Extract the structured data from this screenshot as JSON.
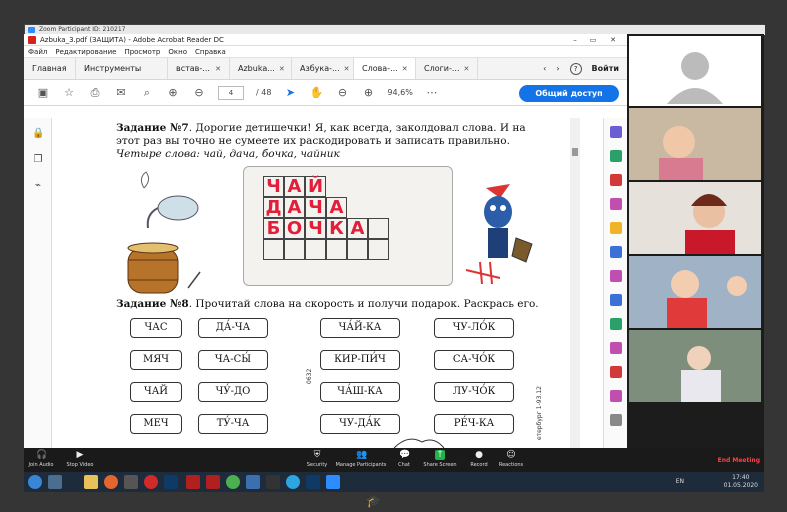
{
  "zoom": {
    "title": "Zoom Participant ID: 210217"
  },
  "acrobat": {
    "title": "Azbuka_3.pdf (ЗАЩИТА) - Adobe Acrobat Reader DC",
    "menu": [
      "Файл",
      "Редактирование",
      "Просмотр",
      "Окно",
      "Справка"
    ],
    "tabs": {
      "home": "Главная",
      "tools": "Инструменты",
      "doc1": "встав-...",
      "doc2": "Azbuka...",
      "doc3": "Азбука-...",
      "doc4": "Слова-...",
      "doc5": "Слоги-..."
    },
    "signin": "Войти",
    "help": "?",
    "page_current": "4",
    "page_total": "/ 48",
    "zoom_level": "94,6%",
    "share_label": "Общий доступ"
  },
  "page": {
    "task7_label": "Задание №7",
    "task7_text": ". Дорогие детишечки! Я, как всегда, заколдовал слова. И на этот раз вы точно не сумеете их раскодировать и записать правильно.",
    "task7_hint": "Четыре слова: чай, дача, бочка, чайник",
    "grid_letters": {
      "row1": [
        "Ч",
        "А",
        "Й"
      ],
      "row2": [
        "Д",
        "А",
        "Ч",
        "А"
      ],
      "row3": [
        "Б",
        "О",
        "Ч",
        "К",
        "А"
      ]
    },
    "task8_label": "Задание №8",
    "task8_text": ". Прочитай слова на скорость и получи подарок. Раскрась его.",
    "words": {
      "c1": [
        "ЧАС",
        "МЯЧ",
        "ЧАЙ",
        "МЕЧ"
      ],
      "c2": [
        "ДА́-ЧА",
        "ЧА-СЫ́",
        "ЧУ́-ДО",
        "ТУ́-ЧА"
      ],
      "c3": [
        "ЧА́Й-КА",
        "КИР-ПИ́Ч",
        "ЧА́Ш-КА",
        "ЧУ-ДА́К"
      ],
      "c4": [
        "ЧУ-ЛО́К",
        "СА-ЧО́К",
        "ЛУ-ЧО́К",
        "РЕ́Ч-КА"
      ]
    },
    "side_code": "0632",
    "side_note": "етербург 1-93.12"
  },
  "zoombar": {
    "join_audio": "Join Audio",
    "stop_video": "Stop Video",
    "security": "Security",
    "manage_participants": "Manage Participants",
    "chat": "Chat",
    "share_screen": "Share Screen",
    "record": "Record",
    "reactions": "Reactions",
    "end_meeting": "End Meeting"
  },
  "taskbar": {
    "lang": "EN",
    "time": "17:40",
    "date": "01.05.2020"
  },
  "colors": {
    "accent": "#1473e6",
    "grid_letter": "#e31e3a",
    "end_meeting": "#ff4040"
  }
}
